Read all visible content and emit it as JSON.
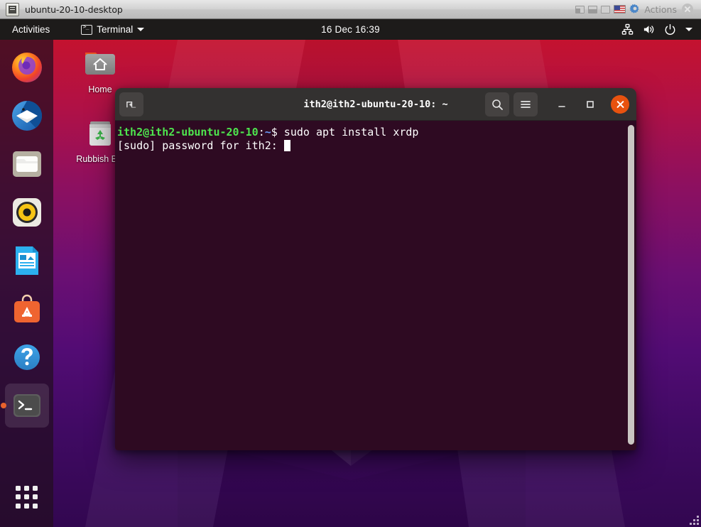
{
  "vm_window": {
    "title": "ubuntu-20-10-desktop",
    "app_icon": "vm-screen-icon",
    "controls": {
      "scale_mode_label": "scale-mode",
      "fullscreen_label": "fullscreen",
      "seamless_label": "seamless",
      "keyboard_layout": "en-US",
      "actions_label": "Actions",
      "close_label": "close"
    }
  },
  "topbar": {
    "activities": "Activities",
    "app_menu": {
      "label": "Terminal",
      "icon": "terminal-icon",
      "chevron": "chevron-down-icon"
    },
    "clock": "16 Dec  16:39",
    "status_icons": [
      "network-wired-icon",
      "volume-icon",
      "power-icon",
      "chevron-down-icon"
    ]
  },
  "dock": {
    "items": [
      {
        "name": "firefox",
        "label": "Firefox Web Browser",
        "active": false
      },
      {
        "name": "thunderbird",
        "label": "Thunderbird Mail",
        "active": false
      },
      {
        "name": "files",
        "label": "Files",
        "active": false
      },
      {
        "name": "rhythmbox",
        "label": "Rhythmbox",
        "active": false
      },
      {
        "name": "libreoffice-impress",
        "label": "LibreOffice Impress",
        "active": false
      },
      {
        "name": "ubuntu-software",
        "label": "Ubuntu Software",
        "active": false
      },
      {
        "name": "help",
        "label": "Help",
        "active": false
      },
      {
        "name": "terminal",
        "label": "Terminal",
        "active": true
      }
    ],
    "show_apps_label": "Show Applications"
  },
  "desktop_icons": [
    {
      "name": "home",
      "label": "Home"
    },
    {
      "name": "rubbish-bin",
      "label": "Rubbish Bin"
    }
  ],
  "terminal": {
    "title": "ith2@ith2-ubuntu-20-10: ~",
    "buttons": {
      "new_tab": "new-tab-icon",
      "search": "search-icon",
      "menu": "hamburger-menu-icon",
      "minimize": "minimize-icon",
      "maximize": "maximize-icon",
      "close": "close-icon"
    },
    "lines": [
      {
        "segments": [
          {
            "text": "ith2@ith2-ubuntu-20-10",
            "style": "green"
          },
          {
            "text": ":",
            "style": "white"
          },
          {
            "text": "~",
            "style": "blue"
          },
          {
            "text": "$ sudo apt install xrdp",
            "style": "white"
          }
        ]
      },
      {
        "segments": [
          {
            "text": "[sudo] password for ith2: ",
            "style": "white"
          }
        ],
        "cursor": true
      }
    ],
    "colors": {
      "background": "#2e0a22",
      "prompt_green": "#4ee44e",
      "prompt_blue": "#6a9bf4",
      "titlebar": "#333130",
      "close_button": "#e8520f"
    }
  },
  "wallpaper": {
    "name": "ubuntu-20-10-groovy-gorilla",
    "top_color": "#c4122f",
    "bottom_color": "#320750"
  }
}
